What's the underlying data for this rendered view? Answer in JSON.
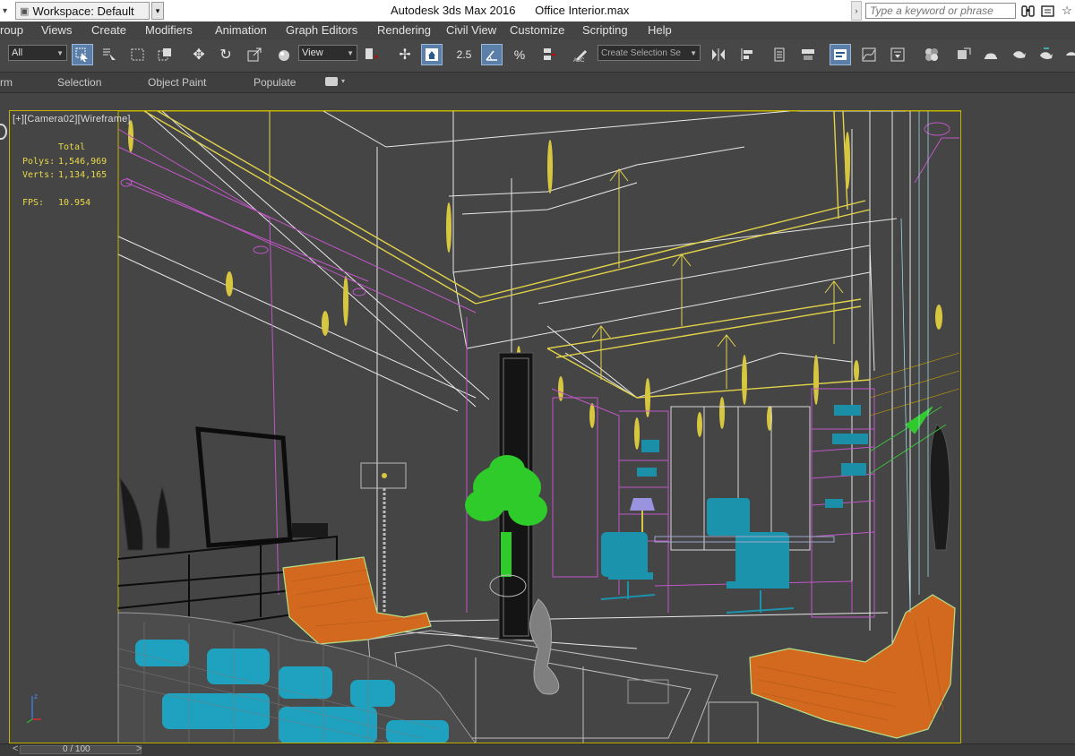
{
  "titlebar": {
    "quick_prefix": "▾",
    "workspace_label": "Workspace: Default",
    "app_name": "Autodesk 3ds Max 2016",
    "file_name": "Office Interior.max",
    "search_placeholder": "Type a keyword or phrase"
  },
  "menu": {
    "items": [
      "roup",
      "Views",
      "Create",
      "Modifiers",
      "Animation",
      "Graph Editors",
      "Rendering",
      "Civil View",
      "Customize",
      "Scripting",
      "Help"
    ]
  },
  "toolbar": {
    "filter_value": "All",
    "refcoord_value": "View",
    "named_selection_value": "Create Selection Se",
    "snap_label": "2.5"
  },
  "ribbon": {
    "tabs": [
      "rm",
      "Selection",
      "Object Paint",
      "Populate"
    ]
  },
  "viewport": {
    "label": "[+][Camera02][Wireframe]",
    "stats": {
      "header": "Total",
      "polys_label": "Polys:",
      "polys_value": "1,546,969",
      "verts_label": "Verts:",
      "verts_value": "1,134,165",
      "fps_label": "FPS:",
      "fps_value": "10.954"
    }
  },
  "timeline": {
    "left_arrow": "<",
    "frame_label": "0 / 100",
    "right_arrow": ">"
  },
  "colors": {
    "viewport_border": "#c5b400",
    "stats_text": "#e8d94a",
    "active_tool": "#5b7fa9"
  }
}
